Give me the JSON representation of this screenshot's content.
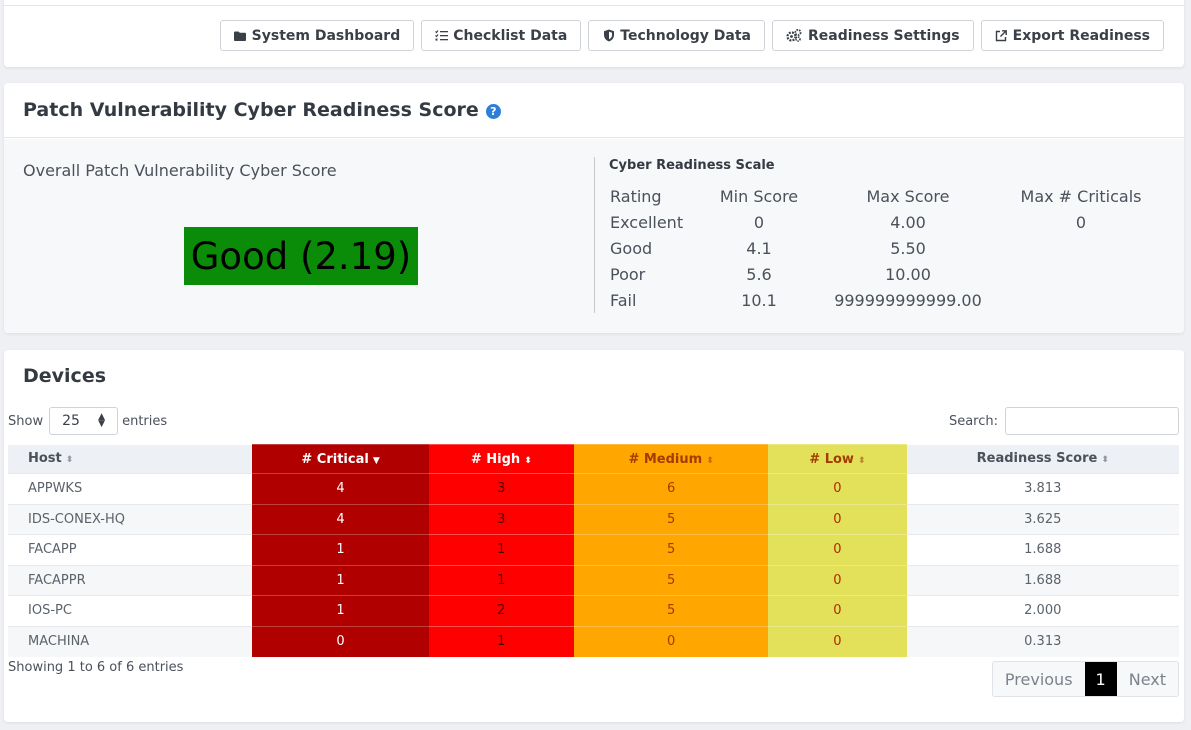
{
  "toolbar": {
    "buttons": [
      {
        "label": "System Dashboard",
        "icon": "folder-icon"
      },
      {
        "label": "Checklist Data",
        "icon": "checklist-icon"
      },
      {
        "label": "Technology Data",
        "icon": "shield-icon"
      },
      {
        "label": "Readiness Settings",
        "icon": "gears-icon"
      },
      {
        "label": "Export Readiness",
        "icon": "external-link-icon"
      }
    ]
  },
  "score_panel": {
    "title": "Patch Vulnerability Cyber Readiness Score",
    "help_icon": "?",
    "overall_label": "Overall Patch Vulnerability Cyber Score",
    "score_text": "Good (2.19)",
    "score_color": "#0a8c08",
    "scale": {
      "title": "Cyber Readiness Scale",
      "headers": [
        "Rating",
        "Min Score",
        "Max Score",
        "Max # Criticals"
      ],
      "rows": [
        [
          "Excellent",
          "0",
          "4.00",
          "0"
        ],
        [
          "Good",
          "4.1",
          "5.50",
          ""
        ],
        [
          "Poor",
          "5.6",
          "10.00",
          ""
        ],
        [
          "Fail",
          "10.1",
          "999999999999.00",
          ""
        ]
      ]
    }
  },
  "devices": {
    "title": "Devices",
    "show_label": "Show",
    "entries_label": "entries",
    "page_length": "25",
    "search_label": "Search:",
    "search_value": "",
    "columns": [
      "Host",
      "# Critical",
      "# High",
      "# Medium",
      "# Low",
      "Readiness Score"
    ],
    "rows": [
      [
        "APPWKS",
        "4",
        "3",
        "6",
        "0",
        "3.813"
      ],
      [
        "IDS-CONEX-HQ",
        "4",
        "3",
        "5",
        "0",
        "3.625"
      ],
      [
        "FACAPP",
        "1",
        "1",
        "5",
        "0",
        "1.688"
      ],
      [
        "FACAPPR",
        "1",
        "1",
        "5",
        "0",
        "1.688"
      ],
      [
        "IOS-PC",
        "1",
        "2",
        "5",
        "0",
        "2.000"
      ],
      [
        "MACHINA",
        "0",
        "1",
        "0",
        "0",
        "0.313"
      ]
    ],
    "info": "Showing 1 to 6 of 6 entries",
    "pagination": {
      "previous": "Previous",
      "current": "1",
      "next": "Next"
    },
    "colors": {
      "critical": "#b00000",
      "high": "#ff0000",
      "medium": "#ffa600",
      "low": "#e3e15a"
    }
  }
}
